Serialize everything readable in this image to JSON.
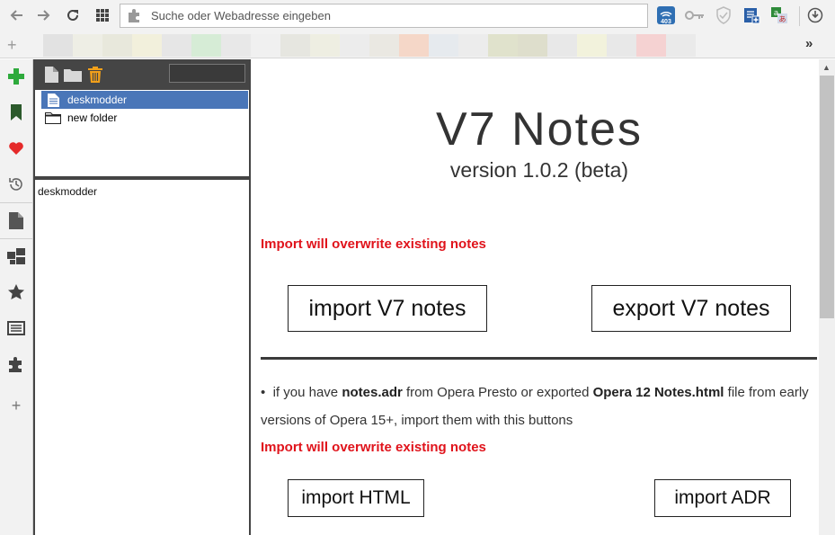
{
  "toolbar": {
    "address_placeholder": "Suche oder Webadresse eingeben",
    "badge_403": "403"
  },
  "bookmarks": {
    "plus": "+",
    "more": "»",
    "tiles": [
      "#e2e2e2",
      "#eeeee5",
      "#e8e8dc",
      "#f2f0dc",
      "#e6e6e6",
      "#d6ecd6",
      "#e8e8e8",
      "#f0f0f0",
      "#e6e6e0",
      "#eeeee2",
      "#ececec",
      "#eae8e2",
      "#f5d7c8",
      "#e6eaee",
      "#ececec",
      "#e0e2cc",
      "#dedecc",
      "#e8e8e8",
      "#f2f2dc",
      "#e8e8e8",
      "#f5d2d2",
      "#eaeaea"
    ]
  },
  "sidebar": {
    "add_more": "+"
  },
  "notes_panel": {
    "tree": [
      {
        "label": "deskmodder",
        "type": "note",
        "selected": true
      },
      {
        "label": "new folder",
        "type": "folder",
        "selected": false
      }
    ],
    "note_content": "deskmodder"
  },
  "main": {
    "title": "V7 Notes",
    "version": "version 1.0.2 (beta)",
    "warning_1": "Import will overwrite existing notes",
    "import_v7_label": "import V7 notes",
    "export_v7_label": "export V7 notes",
    "para": {
      "p1": "if you have ",
      "b1": "notes.adr",
      "p2": " from Opera Presto or exported ",
      "b2": "Opera 12 Notes.html",
      "p3": " file from early versions of Opera 15+, import them with this buttons"
    },
    "warning_2": "Import will overwrite existing notes",
    "import_html_label": "import HTML",
    "import_adr_label": "import ADR"
  },
  "colors": {
    "warning": "#e0131b",
    "selection": "#4a76b8",
    "panel_dark": "#454545"
  }
}
